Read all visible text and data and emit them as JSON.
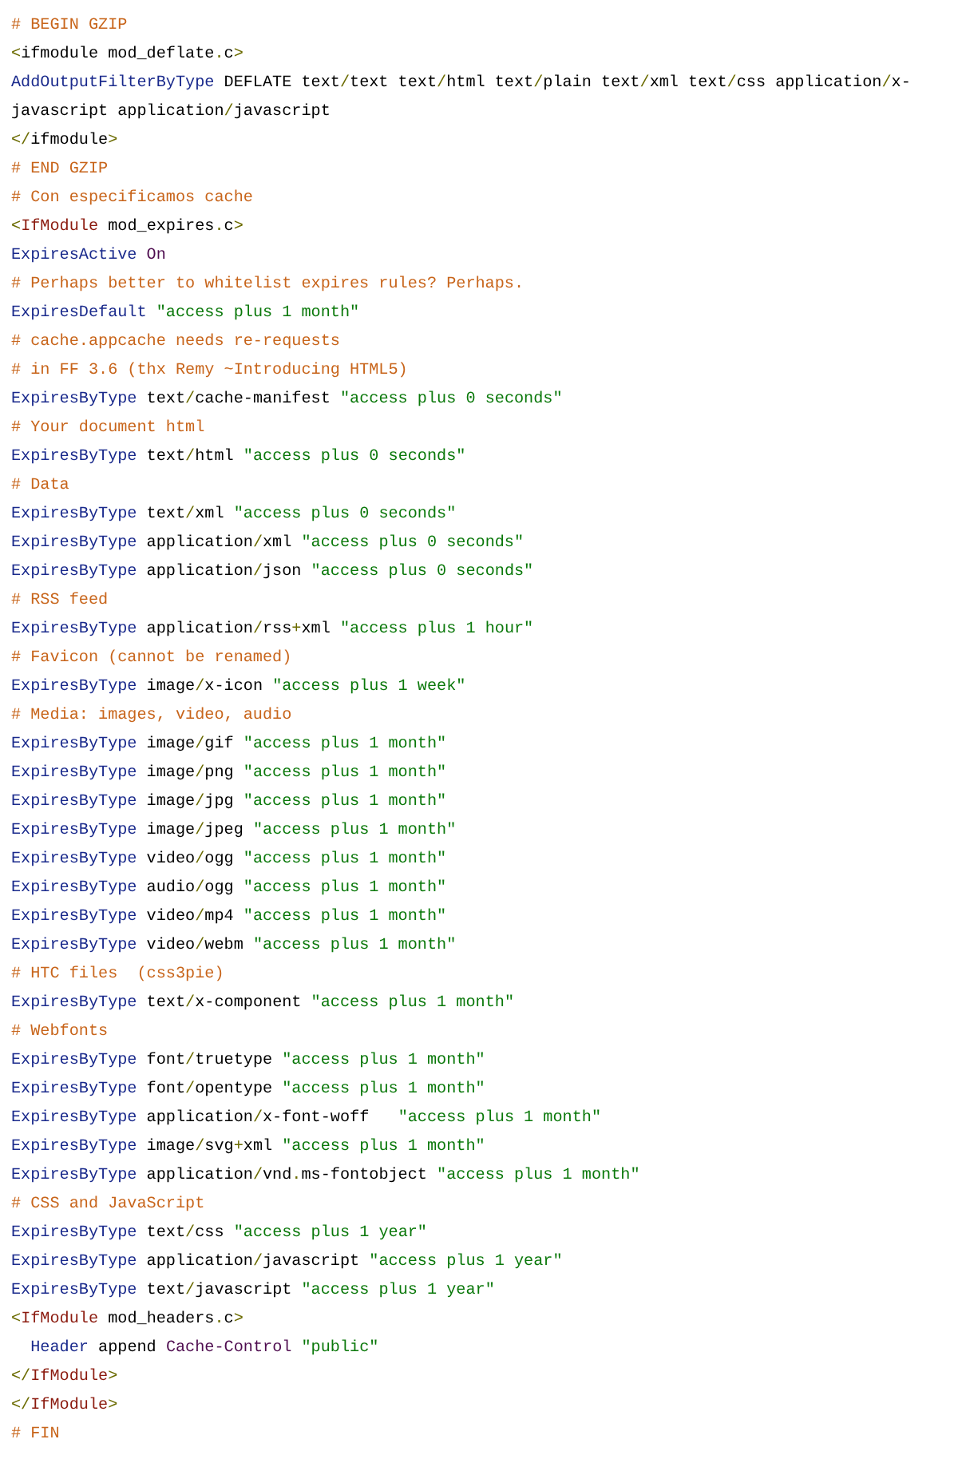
{
  "lines": [
    {
      "tokens": [
        {
          "kind": "comment",
          "text": "# BEGIN GZIP"
        }
      ]
    },
    {
      "tokens": [
        {
          "kind": "punct",
          "text": "<"
        },
        {
          "kind": "plain",
          "text": "ifmodule mod_deflate"
        },
        {
          "kind": "punct",
          "text": "."
        },
        {
          "kind": "plain",
          "text": "c"
        },
        {
          "kind": "punct",
          "text": ">"
        }
      ]
    },
    {
      "tokens": [
        {
          "kind": "directive",
          "text": "AddOutputFilterByType"
        },
        {
          "kind": "plain",
          "text": " DEFLATE text"
        },
        {
          "kind": "punct",
          "text": "/"
        },
        {
          "kind": "plain",
          "text": "text text"
        },
        {
          "kind": "punct",
          "text": "/"
        },
        {
          "kind": "plain",
          "text": "html text"
        },
        {
          "kind": "punct",
          "text": "/"
        },
        {
          "kind": "plain",
          "text": "plain text"
        },
        {
          "kind": "punct",
          "text": "/"
        },
        {
          "kind": "plain",
          "text": "xml text"
        },
        {
          "kind": "punct",
          "text": "/"
        },
        {
          "kind": "plain",
          "text": "css application"
        },
        {
          "kind": "punct",
          "text": "/"
        },
        {
          "kind": "plain",
          "text": "x-javascript application"
        },
        {
          "kind": "punct",
          "text": "/"
        },
        {
          "kind": "plain",
          "text": "javascript"
        }
      ]
    },
    {
      "tokens": [
        {
          "kind": "punct",
          "text": "</"
        },
        {
          "kind": "plain",
          "text": "ifmodule"
        },
        {
          "kind": "punct",
          "text": ">"
        }
      ]
    },
    {
      "tokens": [
        {
          "kind": "comment",
          "text": "# END GZIP"
        }
      ]
    },
    {
      "tokens": [
        {
          "kind": "comment",
          "text": "# Con especificamos cache"
        }
      ]
    },
    {
      "tokens": [
        {
          "kind": "punct",
          "text": "<"
        },
        {
          "kind": "tag",
          "text": "IfModule"
        },
        {
          "kind": "plain",
          "text": " mod_expires"
        },
        {
          "kind": "punct",
          "text": "."
        },
        {
          "kind": "plain",
          "text": "c"
        },
        {
          "kind": "punct",
          "text": ">"
        }
      ]
    },
    {
      "tokens": [
        {
          "kind": "directive",
          "text": "ExpiresActive"
        },
        {
          "kind": "keyword",
          "text": " On"
        }
      ]
    },
    {
      "tokens": [
        {
          "kind": "comment",
          "text": "# Perhaps better to whitelist expires rules? Perhaps."
        }
      ]
    },
    {
      "tokens": [
        {
          "kind": "directive",
          "text": "ExpiresDefault"
        },
        {
          "kind": "string",
          "text": " \"access plus 1 month\""
        }
      ]
    },
    {
      "tokens": [
        {
          "kind": "comment",
          "text": "# cache.appcache needs re-requests"
        }
      ]
    },
    {
      "tokens": [
        {
          "kind": "comment",
          "text": "# in FF 3.6 (thx Remy ~Introducing HTML5)"
        }
      ]
    },
    {
      "tokens": [
        {
          "kind": "directive",
          "text": "ExpiresByType"
        },
        {
          "kind": "plain",
          "text": " text"
        },
        {
          "kind": "punct",
          "text": "/"
        },
        {
          "kind": "plain",
          "text": "cache-manifest "
        },
        {
          "kind": "string",
          "text": "\"access plus 0 seconds\""
        }
      ]
    },
    {
      "tokens": [
        {
          "kind": "comment",
          "text": "# Your document html"
        }
      ]
    },
    {
      "tokens": [
        {
          "kind": "directive",
          "text": "ExpiresByType"
        },
        {
          "kind": "plain",
          "text": " text"
        },
        {
          "kind": "punct",
          "text": "/"
        },
        {
          "kind": "plain",
          "text": "html "
        },
        {
          "kind": "string",
          "text": "\"access plus 0 seconds\""
        }
      ]
    },
    {
      "tokens": [
        {
          "kind": "comment",
          "text": "# Data"
        }
      ]
    },
    {
      "tokens": [
        {
          "kind": "directive",
          "text": "ExpiresByType"
        },
        {
          "kind": "plain",
          "text": " text"
        },
        {
          "kind": "punct",
          "text": "/"
        },
        {
          "kind": "plain",
          "text": "xml "
        },
        {
          "kind": "string",
          "text": "\"access plus 0 seconds\""
        }
      ]
    },
    {
      "tokens": [
        {
          "kind": "directive",
          "text": "ExpiresByType"
        },
        {
          "kind": "plain",
          "text": " application"
        },
        {
          "kind": "punct",
          "text": "/"
        },
        {
          "kind": "plain",
          "text": "xml "
        },
        {
          "kind": "string",
          "text": "\"access plus 0 seconds\""
        }
      ]
    },
    {
      "tokens": [
        {
          "kind": "directive",
          "text": "ExpiresByType"
        },
        {
          "kind": "plain",
          "text": " application"
        },
        {
          "kind": "punct",
          "text": "/"
        },
        {
          "kind": "plain",
          "text": "json "
        },
        {
          "kind": "string",
          "text": "\"access plus 0 seconds\""
        }
      ]
    },
    {
      "tokens": [
        {
          "kind": "comment",
          "text": "# RSS feed"
        }
      ]
    },
    {
      "tokens": [
        {
          "kind": "directive",
          "text": "ExpiresByType"
        },
        {
          "kind": "plain",
          "text": " application"
        },
        {
          "kind": "punct",
          "text": "/"
        },
        {
          "kind": "plain",
          "text": "rss"
        },
        {
          "kind": "punct",
          "text": "+"
        },
        {
          "kind": "plain",
          "text": "xml "
        },
        {
          "kind": "string",
          "text": "\"access plus 1 hour\""
        }
      ]
    },
    {
      "tokens": [
        {
          "kind": "comment",
          "text": "# Favicon (cannot be renamed)"
        }
      ]
    },
    {
      "tokens": [
        {
          "kind": "directive",
          "text": "ExpiresByType"
        },
        {
          "kind": "plain",
          "text": " image"
        },
        {
          "kind": "punct",
          "text": "/"
        },
        {
          "kind": "plain",
          "text": "x-icon "
        },
        {
          "kind": "string",
          "text": "\"access plus 1 week\""
        }
      ]
    },
    {
      "tokens": [
        {
          "kind": "comment",
          "text": "# Media: images, video, audio"
        }
      ]
    },
    {
      "tokens": [
        {
          "kind": "directive",
          "text": "ExpiresByType"
        },
        {
          "kind": "plain",
          "text": " image"
        },
        {
          "kind": "punct",
          "text": "/"
        },
        {
          "kind": "plain",
          "text": "gif "
        },
        {
          "kind": "string",
          "text": "\"access plus 1 month\""
        }
      ]
    },
    {
      "tokens": [
        {
          "kind": "directive",
          "text": "ExpiresByType"
        },
        {
          "kind": "plain",
          "text": " image"
        },
        {
          "kind": "punct",
          "text": "/"
        },
        {
          "kind": "plain",
          "text": "png "
        },
        {
          "kind": "string",
          "text": "\"access plus 1 month\""
        }
      ]
    },
    {
      "tokens": [
        {
          "kind": "directive",
          "text": "ExpiresByType"
        },
        {
          "kind": "plain",
          "text": " image"
        },
        {
          "kind": "punct",
          "text": "/"
        },
        {
          "kind": "plain",
          "text": "jpg "
        },
        {
          "kind": "string",
          "text": "\"access plus 1 month\""
        }
      ]
    },
    {
      "tokens": [
        {
          "kind": "directive",
          "text": "ExpiresByType"
        },
        {
          "kind": "plain",
          "text": " image"
        },
        {
          "kind": "punct",
          "text": "/"
        },
        {
          "kind": "plain",
          "text": "jpeg "
        },
        {
          "kind": "string",
          "text": "\"access plus 1 month\""
        }
      ]
    },
    {
      "tokens": [
        {
          "kind": "directive",
          "text": "ExpiresByType"
        },
        {
          "kind": "plain",
          "text": " video"
        },
        {
          "kind": "punct",
          "text": "/"
        },
        {
          "kind": "plain",
          "text": "ogg "
        },
        {
          "kind": "string",
          "text": "\"access plus 1 month\""
        }
      ]
    },
    {
      "tokens": [
        {
          "kind": "directive",
          "text": "ExpiresByType"
        },
        {
          "kind": "plain",
          "text": " audio"
        },
        {
          "kind": "punct",
          "text": "/"
        },
        {
          "kind": "plain",
          "text": "ogg "
        },
        {
          "kind": "string",
          "text": "\"access plus 1 month\""
        }
      ]
    },
    {
      "tokens": [
        {
          "kind": "directive",
          "text": "ExpiresByType"
        },
        {
          "kind": "plain",
          "text": " video"
        },
        {
          "kind": "punct",
          "text": "/"
        },
        {
          "kind": "plain",
          "text": "mp4 "
        },
        {
          "kind": "string",
          "text": "\"access plus 1 month\""
        }
      ]
    },
    {
      "tokens": [
        {
          "kind": "directive",
          "text": "ExpiresByType"
        },
        {
          "kind": "plain",
          "text": " video"
        },
        {
          "kind": "punct",
          "text": "/"
        },
        {
          "kind": "plain",
          "text": "webm "
        },
        {
          "kind": "string",
          "text": "\"access plus 1 month\""
        }
      ]
    },
    {
      "tokens": [
        {
          "kind": "comment",
          "text": "# HTC files  (css3pie)"
        }
      ]
    },
    {
      "tokens": [
        {
          "kind": "directive",
          "text": "ExpiresByType"
        },
        {
          "kind": "plain",
          "text": " text"
        },
        {
          "kind": "punct",
          "text": "/"
        },
        {
          "kind": "plain",
          "text": "x-component "
        },
        {
          "kind": "string",
          "text": "\"access plus 1 month\""
        }
      ]
    },
    {
      "tokens": [
        {
          "kind": "comment",
          "text": "# Webfonts"
        }
      ]
    },
    {
      "tokens": [
        {
          "kind": "directive",
          "text": "ExpiresByType"
        },
        {
          "kind": "plain",
          "text": " font"
        },
        {
          "kind": "punct",
          "text": "/"
        },
        {
          "kind": "plain",
          "text": "truetype "
        },
        {
          "kind": "string",
          "text": "\"access plus 1 month\""
        }
      ]
    },
    {
      "tokens": [
        {
          "kind": "directive",
          "text": "ExpiresByType"
        },
        {
          "kind": "plain",
          "text": " font"
        },
        {
          "kind": "punct",
          "text": "/"
        },
        {
          "kind": "plain",
          "text": "opentype "
        },
        {
          "kind": "string",
          "text": "\"access plus 1 month\""
        }
      ]
    },
    {
      "tokens": [
        {
          "kind": "directive",
          "text": "ExpiresByType"
        },
        {
          "kind": "plain",
          "text": " application"
        },
        {
          "kind": "punct",
          "text": "/"
        },
        {
          "kind": "plain",
          "text": "x-font-woff   "
        },
        {
          "kind": "string",
          "text": "\"access plus 1 month\""
        }
      ]
    },
    {
      "tokens": [
        {
          "kind": "directive",
          "text": "ExpiresByType"
        },
        {
          "kind": "plain",
          "text": " image"
        },
        {
          "kind": "punct",
          "text": "/"
        },
        {
          "kind": "plain",
          "text": "svg"
        },
        {
          "kind": "punct",
          "text": "+"
        },
        {
          "kind": "plain",
          "text": "xml "
        },
        {
          "kind": "string",
          "text": "\"access plus 1 month\""
        }
      ]
    },
    {
      "tokens": [
        {
          "kind": "directive",
          "text": "ExpiresByType"
        },
        {
          "kind": "plain",
          "text": " application"
        },
        {
          "kind": "punct",
          "text": "/"
        },
        {
          "kind": "plain",
          "text": "vnd"
        },
        {
          "kind": "punct",
          "text": "."
        },
        {
          "kind": "plain",
          "text": "ms-fontobject "
        },
        {
          "kind": "string",
          "text": "\"access plus 1 month\""
        }
      ]
    },
    {
      "tokens": [
        {
          "kind": "comment",
          "text": "# CSS and JavaScript"
        }
      ]
    },
    {
      "tokens": [
        {
          "kind": "directive",
          "text": "ExpiresByType"
        },
        {
          "kind": "plain",
          "text": " text"
        },
        {
          "kind": "punct",
          "text": "/"
        },
        {
          "kind": "plain",
          "text": "css "
        },
        {
          "kind": "string",
          "text": "\"access plus 1 year\""
        }
      ]
    },
    {
      "tokens": [
        {
          "kind": "directive",
          "text": "ExpiresByType"
        },
        {
          "kind": "plain",
          "text": " application"
        },
        {
          "kind": "punct",
          "text": "/"
        },
        {
          "kind": "plain",
          "text": "javascript "
        },
        {
          "kind": "string",
          "text": "\"access plus 1 year\""
        }
      ]
    },
    {
      "tokens": [
        {
          "kind": "directive",
          "text": "ExpiresByType"
        },
        {
          "kind": "plain",
          "text": " text"
        },
        {
          "kind": "punct",
          "text": "/"
        },
        {
          "kind": "plain",
          "text": "javascript "
        },
        {
          "kind": "string",
          "text": "\"access plus 1 year\""
        }
      ]
    },
    {
      "tokens": [
        {
          "kind": "punct",
          "text": "<"
        },
        {
          "kind": "tag",
          "text": "IfModule"
        },
        {
          "kind": "plain",
          "text": " mod_headers"
        },
        {
          "kind": "punct",
          "text": "."
        },
        {
          "kind": "plain",
          "text": "c"
        },
        {
          "kind": "punct",
          "text": ">"
        }
      ]
    },
    {
      "tokens": [
        {
          "kind": "directive",
          "text": "  Header"
        },
        {
          "kind": "plain",
          "text": " append "
        },
        {
          "kind": "keyword",
          "text": "Cache-Control"
        },
        {
          "kind": "string",
          "text": " \"public\""
        }
      ]
    },
    {
      "tokens": [
        {
          "kind": "punct",
          "text": "</"
        },
        {
          "kind": "tag",
          "text": "IfModule"
        },
        {
          "kind": "punct",
          "text": ">"
        }
      ]
    },
    {
      "tokens": [
        {
          "kind": "punct",
          "text": "</"
        },
        {
          "kind": "tag",
          "text": "IfModule"
        },
        {
          "kind": "punct",
          "text": ">"
        }
      ]
    },
    {
      "tokens": [
        {
          "kind": "comment",
          "text": "# FIN"
        }
      ]
    }
  ]
}
